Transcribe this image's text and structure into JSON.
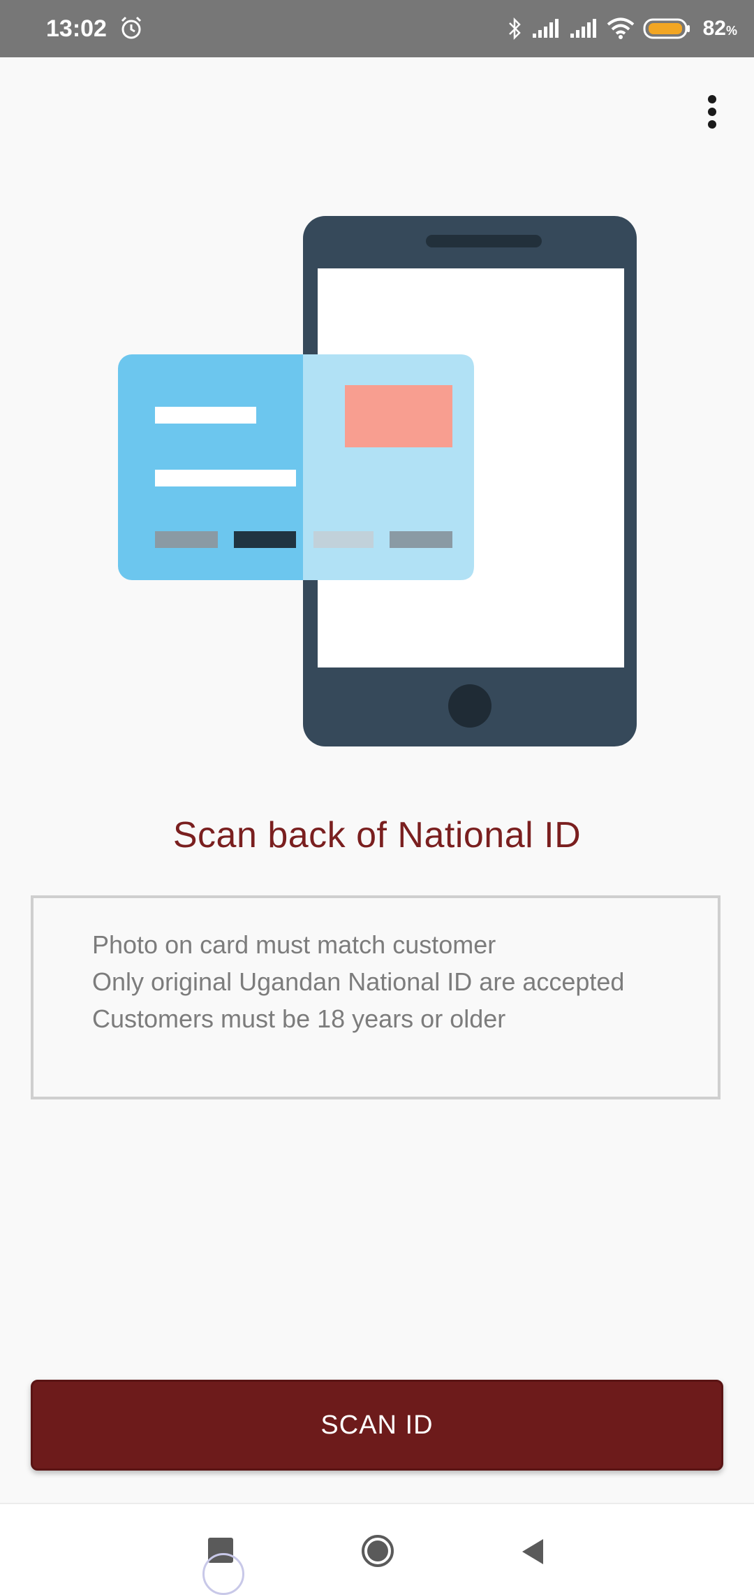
{
  "status_bar": {
    "time": "13:02",
    "battery_percent": "82",
    "battery_unit": "%",
    "icons": [
      "alarm-icon",
      "bluetooth-icon",
      "signal-icon",
      "signal-icon",
      "wifi-icon",
      "battery-icon"
    ]
  },
  "toolbar": {
    "menu_icon": "more-vertical-icon"
  },
  "screen": {
    "title": "Scan back of National ID",
    "requirements": [
      "Photo on card must match customer",
      "Only original Ugandan National ID are accepted",
      "Customers must be 18 years or older"
    ],
    "scan_button_label": "SCAN ID"
  },
  "colors": {
    "title": "#7a1f1f",
    "button": "#6d1b1b",
    "phone_body": "#36495a",
    "card": "#6cc6ee",
    "card_light": "#b1e1f5",
    "photo": "#f89e90"
  },
  "navigation": {
    "items": [
      "recents-button",
      "home-button",
      "back-button"
    ]
  }
}
